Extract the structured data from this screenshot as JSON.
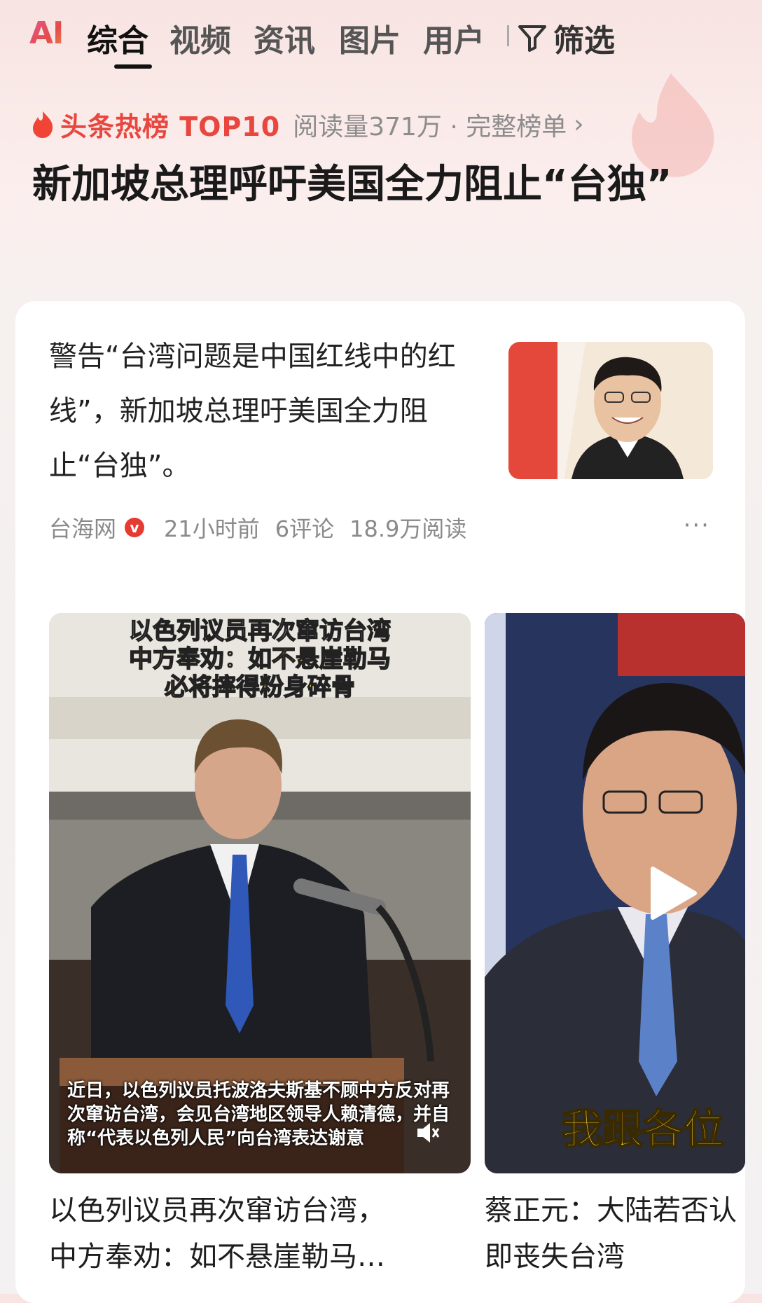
{
  "tabs": {
    "logo": "AI",
    "items": [
      "综合",
      "视频",
      "资讯",
      "图片",
      "用户"
    ],
    "active_index": 0,
    "filter_label": "筛选"
  },
  "hot": {
    "brand": "头条热榜 TOP10",
    "meta": "阅读量371万 · 完整榜单",
    "chevron": "›",
    "headline": "新加坡总理呼吁美国全力阻止“台独”"
  },
  "article": {
    "summary": "警告“台湾问题是中国红线中的红线”，新加坡总理吁美国全力阻止“台独”。",
    "source": "台海网",
    "verified_badge": "v",
    "time": "21小时前",
    "comments": "6评论",
    "reads": "18.9万阅读",
    "more": "···"
  },
  "videos": [
    {
      "caption_line1": "以色列议员再次窜访台湾",
      "caption_line2": "中方奉劝：如不悬崖勒马",
      "caption_line3": "必将摔得粉身碎骨",
      "subtitle": "近日，以色列议员托波洛夫斯基不顾中方反对再次窜访台湾，会见台湾地区领导人赖清德，并自称“代表以色列人民”向台湾表达谢意",
      "title_line1": "以色列议员再次窜访台湾，",
      "title_line2": "中方奉劝：如不悬崖勒马…"
    },
    {
      "overlay_text": "我跟各位",
      "title_line1": "蔡正元：大陆若否认",
      "title_line2": "即丧失台湾"
    }
  ],
  "colors": {
    "brand_red": "#e8463e",
    "tab_active": "#111111",
    "meta_gray": "#8a8a8a"
  },
  "icons": [
    "filter-icon",
    "flame-icon",
    "verified-icon",
    "more-icon",
    "play-icon",
    "mute-icon"
  ]
}
